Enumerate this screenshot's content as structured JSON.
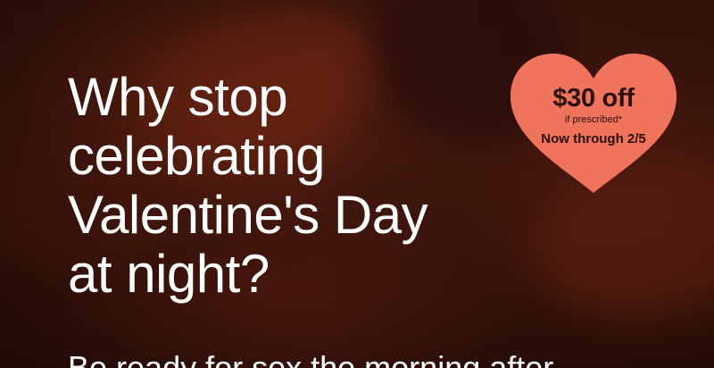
{
  "hero": {
    "headline": "Why stop\ncelebrating\nValentine's Day\nat night?",
    "subline": "Be ready for sex the morning after"
  },
  "promo_badge": {
    "shape": "heart",
    "color": "#f0735c",
    "amount": "$30 off",
    "note": "if prescribed*",
    "dates": "Now through 2/5"
  },
  "colors": {
    "text": "#ffffff",
    "badge_text": "#2a0e08",
    "background": "#3a150c"
  }
}
